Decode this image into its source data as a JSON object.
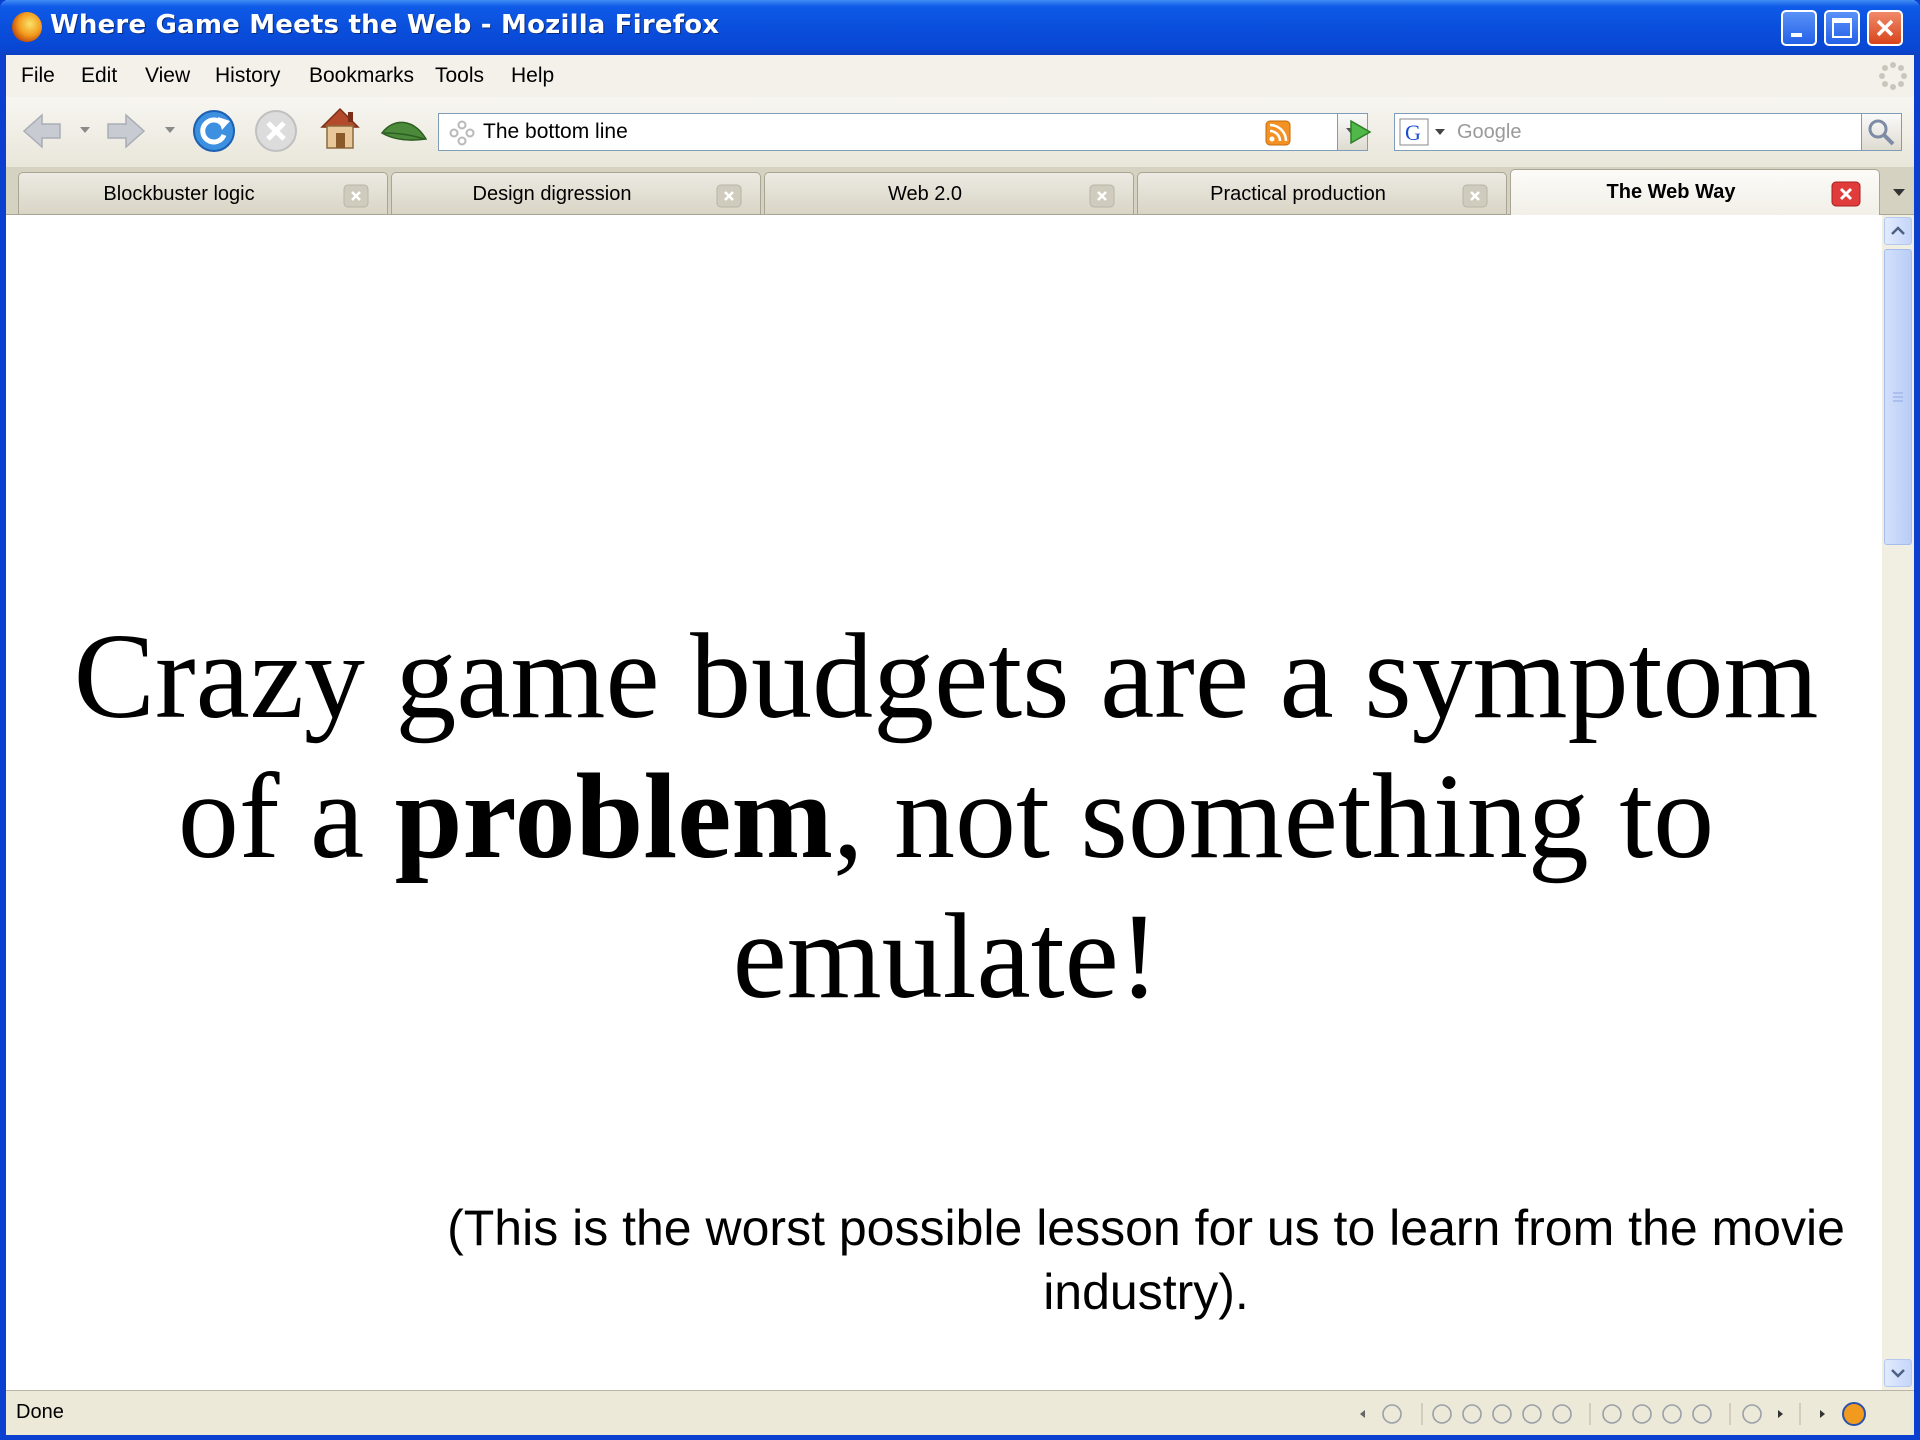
{
  "window": {
    "title": "Where Game Meets the Web - Mozilla Firefox"
  },
  "menu": {
    "items": [
      "File",
      "Edit",
      "View",
      "History",
      "Bookmarks",
      "Tools",
      "Help"
    ]
  },
  "toolbar": {
    "url": "The bottom line",
    "search_placeholder": "Google"
  },
  "tabs": [
    {
      "label": "Blockbuster logic",
      "active": false
    },
    {
      "label": "Design digression",
      "active": false
    },
    {
      "label": "Web 2.0",
      "active": false
    },
    {
      "label": "Practical production",
      "active": false
    },
    {
      "label": "The Web Way",
      "active": true
    }
  ],
  "slide": {
    "line1": "Crazy game budgets are a symptom",
    "line2_pre": "of a ",
    "line2_bold": "problem",
    "line2_post": ", not something to",
    "line3": "emulate!",
    "note": "(This is the worst possible lesson for us to learn from the movie industry)."
  },
  "status": {
    "text": "Done"
  },
  "colors": {
    "titlebar": "#0a4fdc",
    "accent_close": "#d8441c",
    "tab_close_active": "#e03c3c"
  }
}
